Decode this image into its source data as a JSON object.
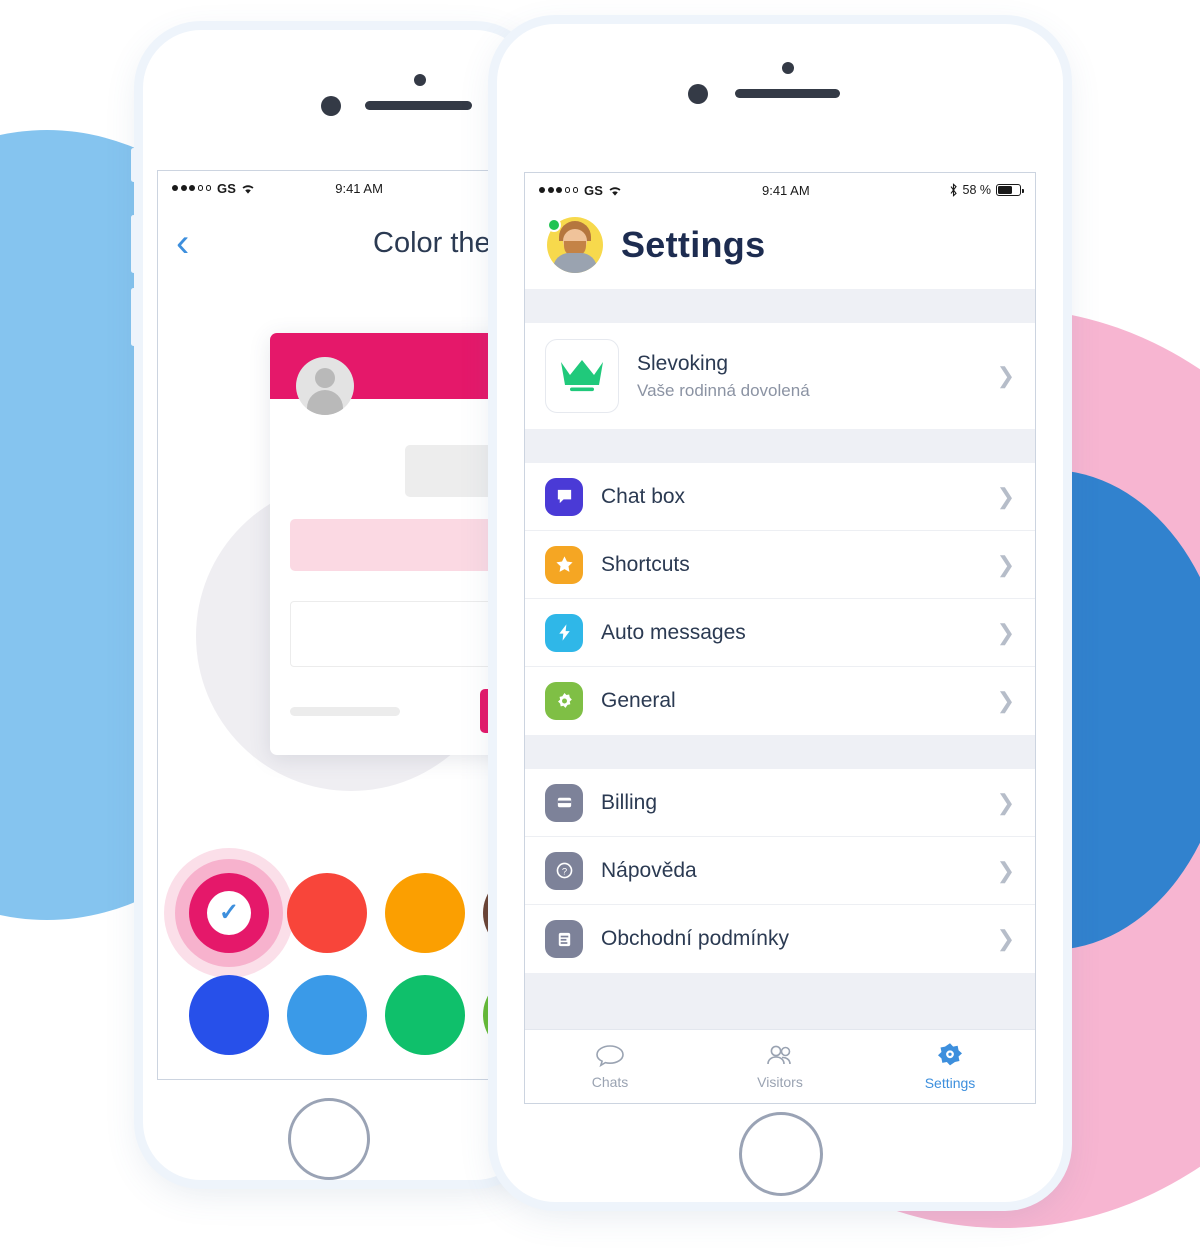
{
  "colors": {
    "accent_blue": "#3d8fdd",
    "brand_pink": "#e5186a",
    "blob_blue_left": "#85c4ef",
    "blob_pink_right": "#f7b5d1",
    "blob_blue_right": "#3182ce",
    "online_green": "#21c352",
    "title_navy": "#1d2c50"
  },
  "left_phone": {
    "status_bar": {
      "carrier": "GS",
      "signal_filled": 3,
      "signal_total": 5,
      "wifi_icon": "wifi-icon",
      "time": "9:41 AM"
    },
    "navbar": {
      "back_icon": "back-chevron-icon",
      "title": "Color theme"
    },
    "preview_card": {
      "avatar_icon": "user-avatar-icon",
      "send_icon": "send-lines-icon"
    },
    "swatches": [
      {
        "name": "pink",
        "hex": "#e5186a",
        "selected": true,
        "check_icon": "check-icon"
      },
      {
        "name": "red",
        "hex": "#f8453a",
        "selected": false
      },
      {
        "name": "orange",
        "hex": "#fb9f01",
        "selected": false
      },
      {
        "name": "brown",
        "hex": "#6b4233",
        "selected": false
      },
      {
        "name": "indigo",
        "hex": "#2750ea",
        "selected": false
      },
      {
        "name": "light-blue",
        "hex": "#3a9ae8",
        "selected": false
      },
      {
        "name": "green",
        "hex": "#0fc06b",
        "selected": false
      },
      {
        "name": "lime",
        "hex": "#65bb35",
        "selected": false
      }
    ]
  },
  "right_phone": {
    "status_bar": {
      "carrier": "GS",
      "signal_filled": 3,
      "signal_total": 5,
      "wifi_icon": "wifi-icon",
      "time": "9:41 AM",
      "bluetooth_icon": "bluetooth-icon",
      "battery_percent": "58 %"
    },
    "header": {
      "avatar_icon": "user-avatar-photo",
      "presence": "online",
      "title": "Settings"
    },
    "promo": {
      "icon": "crown-icon",
      "icon_color": "#20c97b",
      "title": "Slevoking",
      "subtitle": "Vaše rodinná dovolená",
      "chevron": "chevron-right-icon"
    },
    "group_one": [
      {
        "label": "Chat box",
        "icon": "chat-bubble-icon",
        "color": "#4a3ad6",
        "chevron": "chevron-right-icon"
      },
      {
        "label": "Shortcuts",
        "icon": "star-icon",
        "color": "#f5a623",
        "chevron": "chevron-right-icon"
      },
      {
        "label": "Auto messages",
        "icon": "bolt-icon",
        "color": "#2fb7e8",
        "chevron": "chevron-right-icon"
      },
      {
        "label": "General",
        "icon": "gear-icon",
        "color": "#7fbf45",
        "chevron": "chevron-right-icon"
      }
    ],
    "group_two": [
      {
        "label": "Billing",
        "icon": "card-icon",
        "color": "#7d8299",
        "chevron": "chevron-right-icon"
      },
      {
        "label": "Nápověda",
        "icon": "question-icon",
        "color": "#7d8299",
        "chevron": "chevron-right-icon"
      },
      {
        "label": "Obchodní podmínky",
        "icon": "document-icon",
        "color": "#7d8299",
        "chevron": "chevron-right-icon"
      }
    ],
    "tabs": [
      {
        "label": "Chats",
        "icon": "chat-outline-icon",
        "active": false
      },
      {
        "label": "Visitors",
        "icon": "visitors-people-icon",
        "active": false
      },
      {
        "label": "Settings",
        "icon": "gear-filled-icon",
        "active": true
      }
    ]
  }
}
